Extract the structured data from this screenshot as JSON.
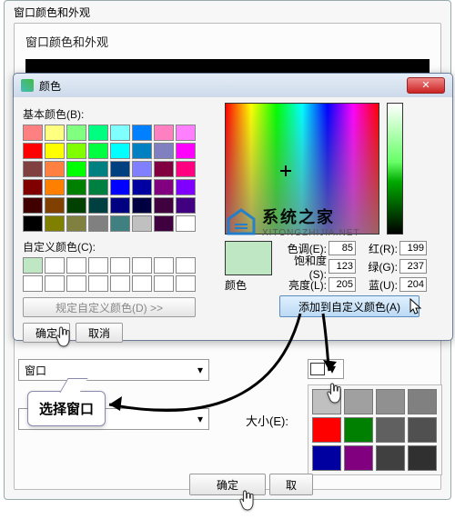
{
  "outerWindow": {
    "title_blur": "窗口颜色和外观",
    "header": "窗口颜色和外观"
  },
  "colorDialog": {
    "title": "颜色",
    "close": "✕",
    "basic_label": "基本颜色(B):",
    "custom_label": "自定义颜色(C):",
    "define_btn": "规定自定义颜色(D) >>",
    "ok": "确定",
    "cancel": "取消",
    "preview_label": "颜色",
    "hue_k": "色调(E):",
    "hue_v": "85",
    "sat_k": "饱和度(S):",
    "sat_v": "123",
    "lum_k": "亮度(L):",
    "lum_v": "205",
    "red_k": "红(R):",
    "red_v": "199",
    "green_k": "绿(G):",
    "green_v": "237",
    "blue_k": "蓝(U):",
    "blue_v": "204",
    "add_btn": "添加到自定义颜色(A)",
    "basic_colors": [
      "#ff8080",
      "#ffff80",
      "#80ff80",
      "#00ff80",
      "#80ffff",
      "#0080ff",
      "#ff80c0",
      "#ff80ff",
      "#ff0000",
      "#ffff00",
      "#80ff00",
      "#00ff40",
      "#00ffff",
      "#0080c0",
      "#8080c0",
      "#ff00ff",
      "#804040",
      "#ff8040",
      "#00ff00",
      "#008080",
      "#004080",
      "#8080ff",
      "#800040",
      "#ff0080",
      "#800000",
      "#ff8000",
      "#008000",
      "#008040",
      "#0000ff",
      "#0000a0",
      "#800080",
      "#8000ff",
      "#400000",
      "#804000",
      "#004000",
      "#004040",
      "#000080",
      "#000040",
      "#400040",
      "#400080",
      "#000000",
      "#808000",
      "#808040",
      "#808080",
      "#408080",
      "#c0c0c0",
      "#400040",
      "#ffffff"
    ],
    "custom_first": "#bfe7c4"
  },
  "bottom": {
    "item_label": "窗口",
    "size_label": "大小(E):",
    "ok": "确定",
    "cancel_partial": "取"
  },
  "miniPalette": [
    "#c0c0c0",
    "#a0a0a0",
    "#909090",
    "#808080",
    "#ff0000",
    "#008000",
    "#606060",
    "#505050",
    "#0000a0",
    "#800080",
    "#404040",
    "#303030"
  ],
  "callout": "选择窗口",
  "watermark": {
    "brand": "系统之家",
    "url": "XITONGZHIJIA.NET"
  }
}
